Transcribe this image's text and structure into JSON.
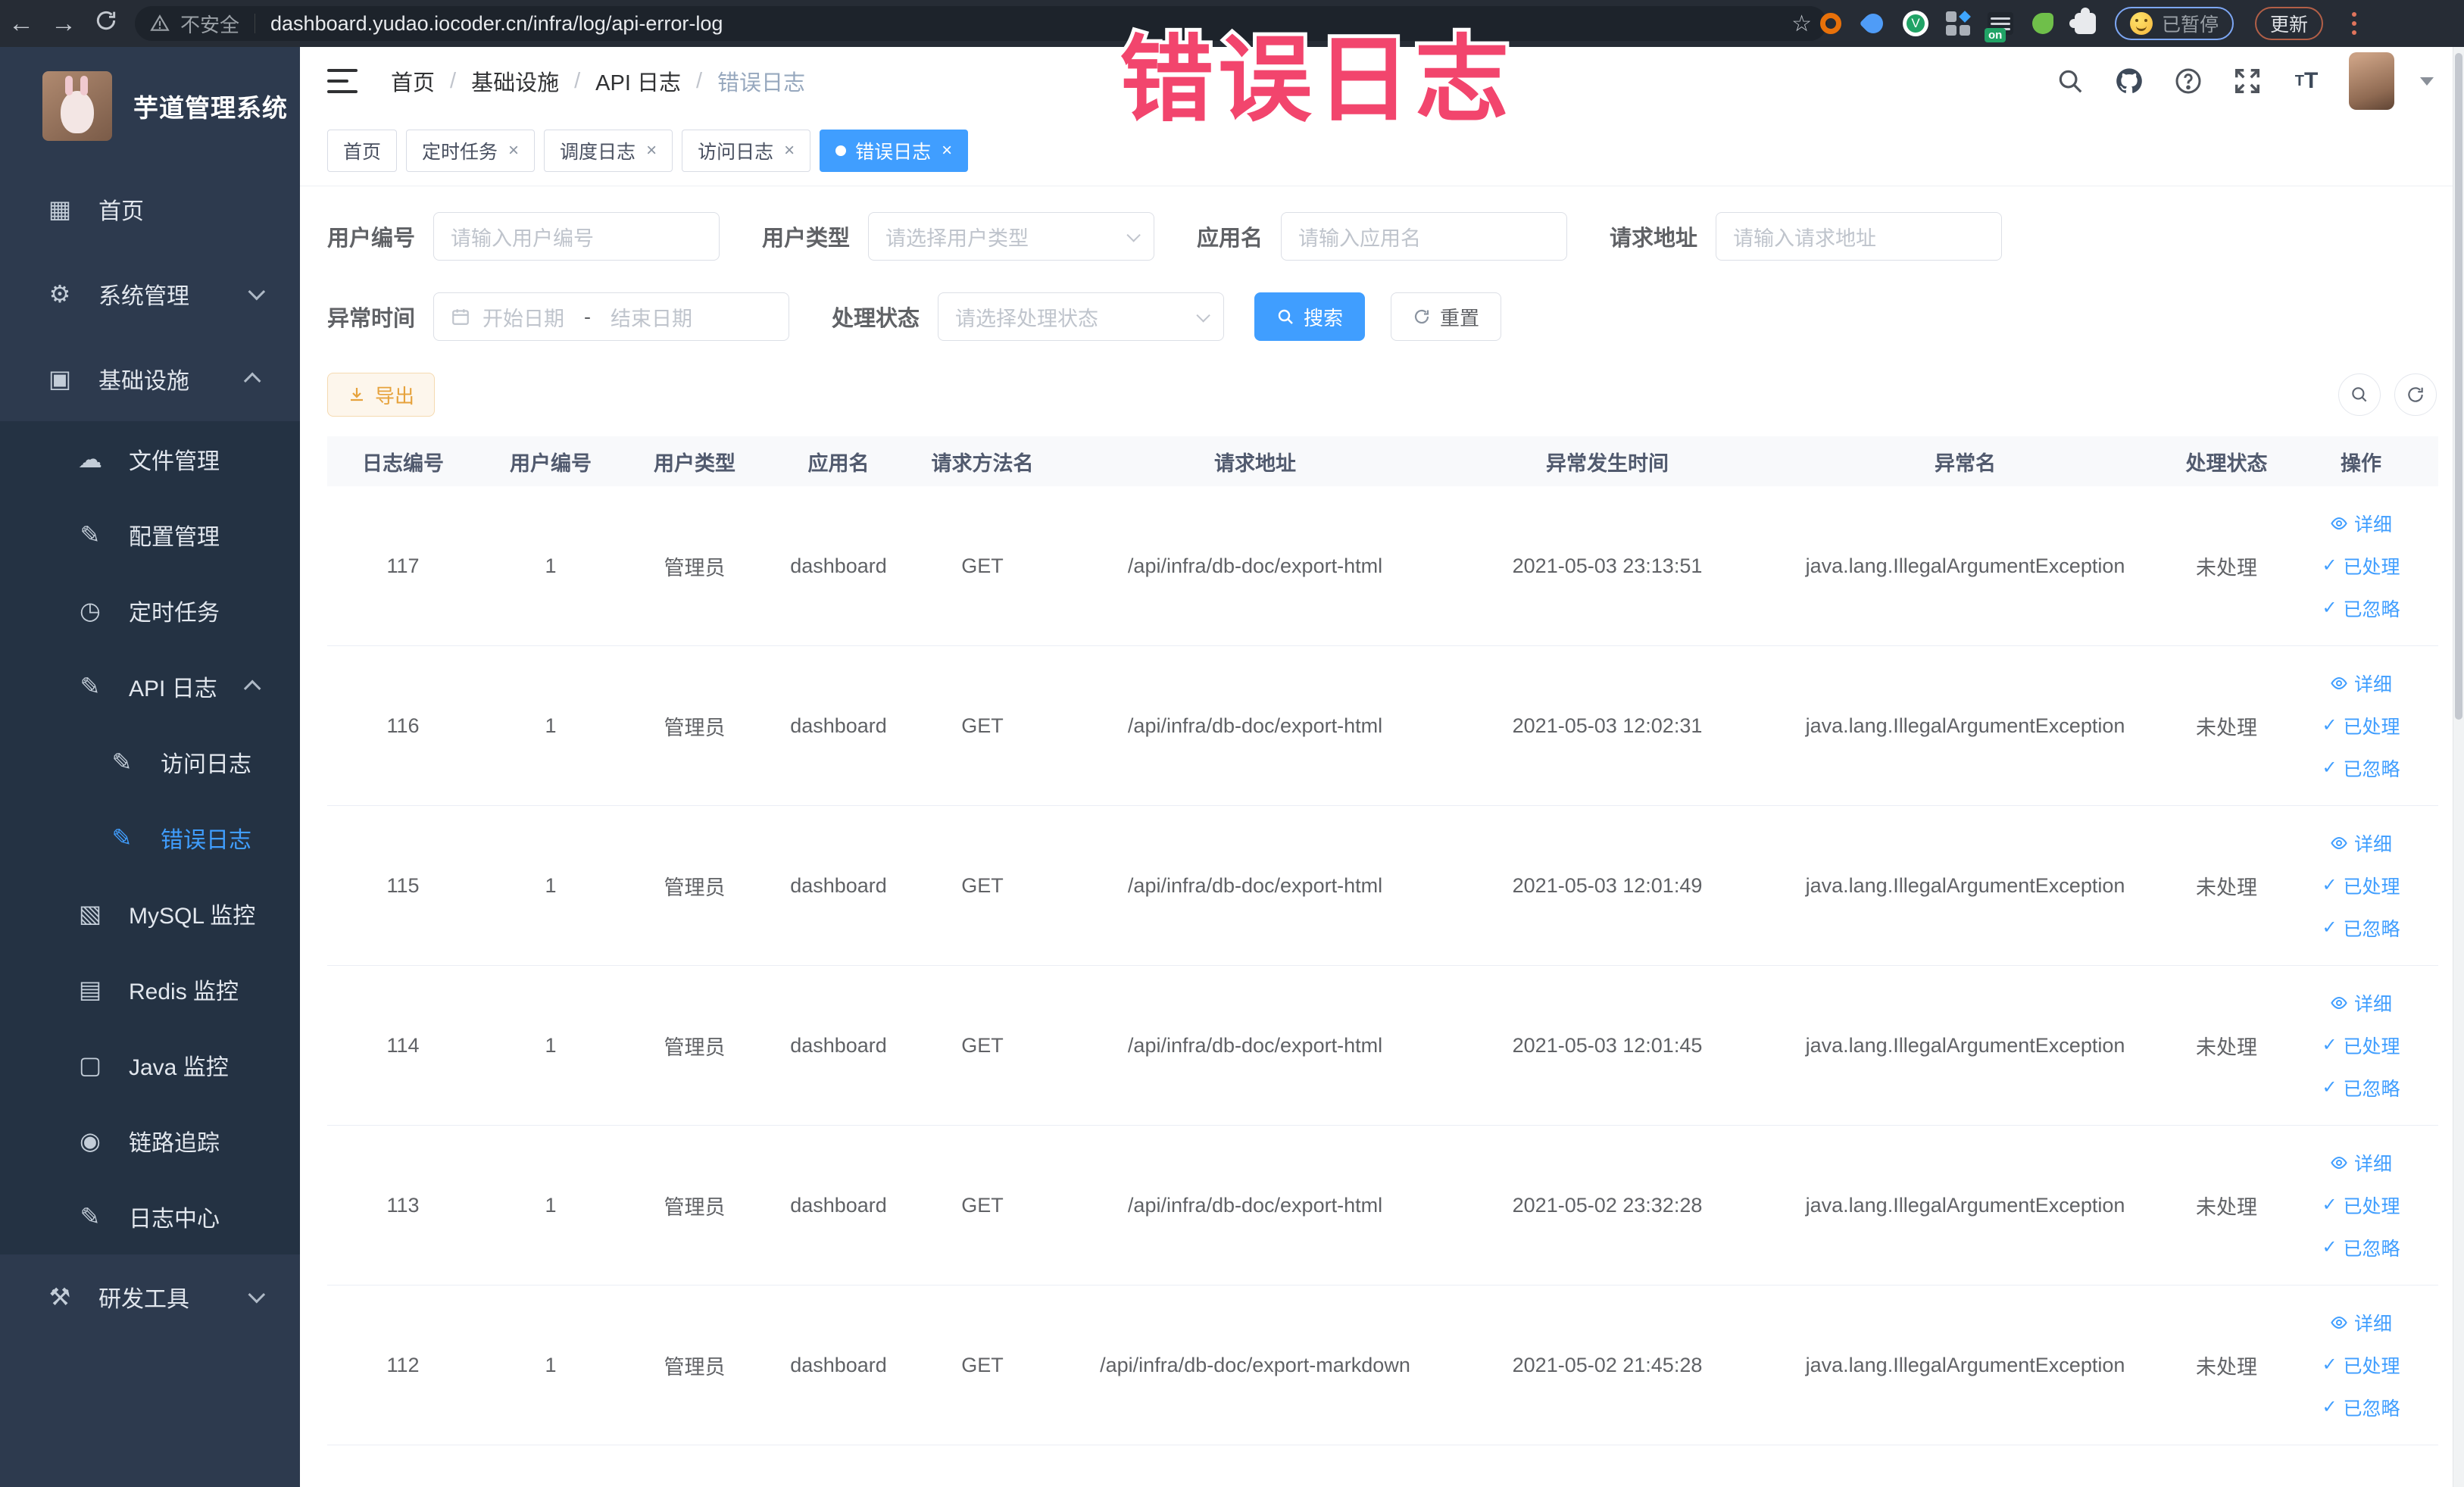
{
  "overlay": {
    "title": "错误日志",
    "color": "#f2456d"
  },
  "browser": {
    "security_label": "不安全",
    "url": "dashboard.yudao.iocoder.cn/infra/log/api-error-log",
    "extension_badge": "on",
    "paused_label": "已暂停",
    "update_label": "更新"
  },
  "sidebar": {
    "title": "芋道管理系统",
    "items": [
      {
        "label": "首页",
        "icon": "dashboard-icon",
        "level": 0,
        "zone": "light"
      },
      {
        "label": "系统管理",
        "icon": "gear-icon",
        "level": 0,
        "zone": "light",
        "chevron": "down"
      },
      {
        "label": "基础设施",
        "icon": "monitor-icon",
        "level": 0,
        "zone": "light",
        "chevron": "up"
      },
      {
        "label": "文件管理",
        "icon": "cloud-upload-icon",
        "level": 1,
        "zone": "dark"
      },
      {
        "label": "配置管理",
        "icon": "edit-icon",
        "level": 1,
        "zone": "dark"
      },
      {
        "label": "定时任务",
        "icon": "clock-icon",
        "level": 1,
        "zone": "dark"
      },
      {
        "label": "API 日志",
        "icon": "log-icon",
        "level": 1,
        "zone": "dark",
        "chevron": "up"
      },
      {
        "label": "访问日志",
        "icon": "log-icon",
        "level": 2,
        "zone": "dark"
      },
      {
        "label": "错误日志",
        "icon": "log-icon",
        "level": 2,
        "zone": "dark",
        "active": true
      },
      {
        "label": "MySQL 监控",
        "icon": "chart-icon",
        "level": 1,
        "zone": "dark"
      },
      {
        "label": "Redis 监控",
        "icon": "layers-icon",
        "level": 1,
        "zone": "dark"
      },
      {
        "label": "Java 监控",
        "icon": "screen-icon",
        "level": 1,
        "zone": "dark"
      },
      {
        "label": "链路追踪",
        "icon": "eye-icon",
        "level": 1,
        "zone": "dark"
      },
      {
        "label": "日志中心",
        "icon": "log-icon",
        "level": 1,
        "zone": "dark"
      },
      {
        "label": "研发工具",
        "icon": "tools-icon",
        "level": 0,
        "zone": "light",
        "chevron": "down"
      }
    ]
  },
  "header": {
    "breadcrumb": [
      "首页",
      "基础设施",
      "API 日志",
      "错误日志"
    ],
    "breadcrumb_separator": "/",
    "tabs": [
      {
        "label": "首页",
        "closable": false,
        "active": false
      },
      {
        "label": "定时任务",
        "closable": true,
        "active": false
      },
      {
        "label": "调度日志",
        "closable": true,
        "active": false
      },
      {
        "label": "访问日志",
        "closable": true,
        "active": false
      },
      {
        "label": "错误日志",
        "closable": true,
        "active": true
      }
    ]
  },
  "filters": {
    "user_id": {
      "label": "用户编号",
      "placeholder": "请输入用户编号"
    },
    "user_type": {
      "label": "用户类型",
      "placeholder": "请选择用户类型"
    },
    "app_name": {
      "label": "应用名",
      "placeholder": "请输入应用名"
    },
    "request_url": {
      "label": "请求地址",
      "placeholder": "请输入请求地址"
    },
    "exception_time": {
      "label": "异常时间",
      "start_placeholder": "开始日期",
      "separator": "-",
      "end_placeholder": "结束日期"
    },
    "process_status": {
      "label": "处理状态",
      "placeholder": "请选择处理状态"
    },
    "search_label": "搜索",
    "reset_label": "重置"
  },
  "toolbar": {
    "export_label": "导出"
  },
  "table": {
    "columns": [
      "日志编号",
      "用户编号",
      "用户类型",
      "应用名",
      "请求方法名",
      "请求地址",
      "异常发生时间",
      "异常名",
      "处理状态",
      "操作"
    ],
    "actions": [
      "详细",
      "已处理",
      "已忽略"
    ],
    "rows": [
      {
        "id": "117",
        "user_id": "1",
        "user_type": "管理员",
        "app": "dashboard",
        "method": "GET",
        "url": "/api/infra/db-doc/export-html",
        "time": "2021-05-03 23:13:51",
        "exception": "java.lang.IllegalArgumentException",
        "status": "未处理"
      },
      {
        "id": "116",
        "user_id": "1",
        "user_type": "管理员",
        "app": "dashboard",
        "method": "GET",
        "url": "/api/infra/db-doc/export-html",
        "time": "2021-05-03 12:02:31",
        "exception": "java.lang.IllegalArgumentException",
        "status": "未处理"
      },
      {
        "id": "115",
        "user_id": "1",
        "user_type": "管理员",
        "app": "dashboard",
        "method": "GET",
        "url": "/api/infra/db-doc/export-html",
        "time": "2021-05-03 12:01:49",
        "exception": "java.lang.IllegalArgumentException",
        "status": "未处理"
      },
      {
        "id": "114",
        "user_id": "1",
        "user_type": "管理员",
        "app": "dashboard",
        "method": "GET",
        "url": "/api/infra/db-doc/export-html",
        "time": "2021-05-03 12:01:45",
        "exception": "java.lang.IllegalArgumentException",
        "status": "未处理"
      },
      {
        "id": "113",
        "user_id": "1",
        "user_type": "管理员",
        "app": "dashboard",
        "method": "GET",
        "url": "/api/infra/db-doc/export-html",
        "time": "2021-05-02 23:32:28",
        "exception": "java.lang.IllegalArgumentException",
        "status": "未处理"
      },
      {
        "id": "112",
        "user_id": "1",
        "user_type": "管理员",
        "app": "dashboard",
        "method": "GET",
        "url": "/api/infra/db-doc/export-markdown",
        "time": "2021-05-02 21:45:28",
        "exception": "java.lang.IllegalArgumentException",
        "status": "未处理"
      }
    ]
  },
  "colors": {
    "accent": "#409eff",
    "sidebar_bg": "#2d3a4e",
    "submenu_bg": "#243243",
    "export_text": "#e6a23c",
    "annotation": "#f2456d"
  }
}
